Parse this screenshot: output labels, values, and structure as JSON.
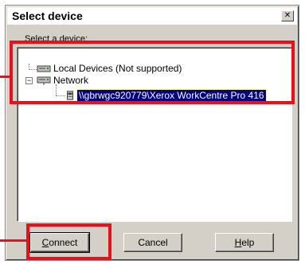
{
  "dialog": {
    "title": "Select device",
    "close_glyph": "✕",
    "caption": "Select a device:"
  },
  "tree": {
    "nodes": [
      {
        "label": "Local Devices (Not supported)",
        "icon": "computer-icon"
      },
      {
        "label": "Network",
        "icon": "network-icon",
        "expander": "−"
      },
      {
        "label": "\\\\gbrwgc920779\\Xerox WorkCentre Pro 416",
        "icon": "printer-icon",
        "selected": true
      }
    ]
  },
  "buttons": {
    "connect": {
      "label_underline": "C",
      "label_rest": "onnect"
    },
    "cancel": {
      "label": "Cancel"
    },
    "help": {
      "label_underline": "H",
      "label_rest": "elp"
    }
  },
  "colors": {
    "highlight_box": "#e8101a",
    "selection": "#000080",
    "face": "#d4d0c8"
  }
}
